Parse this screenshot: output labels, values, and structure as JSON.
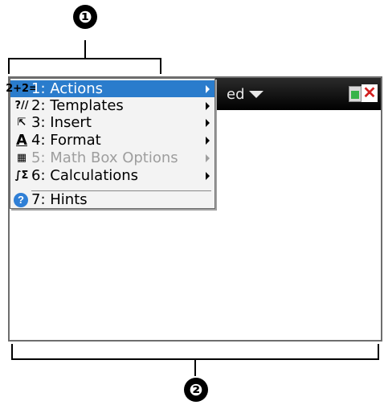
{
  "callouts": {
    "top": "❶",
    "bottom": "❷"
  },
  "document": {
    "title_fragment": "ed"
  },
  "menu": {
    "items": [
      {
        "num": "1:",
        "label": "Actions",
        "icon": "2+2=",
        "state": "highlighted",
        "has_submenu": true
      },
      {
        "num": "2:",
        "label": "Templates",
        "icon": "?//",
        "state": "enabled",
        "has_submenu": true
      },
      {
        "num": "3:",
        "label": "Insert",
        "icon": "⇱",
        "state": "enabled",
        "has_submenu": true
      },
      {
        "num": "4:",
        "label": "Format",
        "icon": "A",
        "state": "enabled",
        "has_submenu": true
      },
      {
        "num": "5:",
        "label": "Math Box Options",
        "icon": "▦",
        "state": "disabled",
        "has_submenu": true
      },
      {
        "num": "6:",
        "label": "Calculations",
        "icon": "∫Σ",
        "state": "enabled",
        "has_submenu": true
      },
      {
        "num": "7:",
        "label": "Hints",
        "icon": "?",
        "state": "enabled",
        "has_submenu": false
      }
    ]
  },
  "colors": {
    "menu_highlight": "#2a7ccc",
    "titlebar": "#000000",
    "close_icon": "#d21f1f"
  },
  "icons": {
    "close": "close-icon",
    "battery": "battery-icon",
    "document_menu": "chevron-down-icon",
    "hints": "help-circle-icon"
  }
}
